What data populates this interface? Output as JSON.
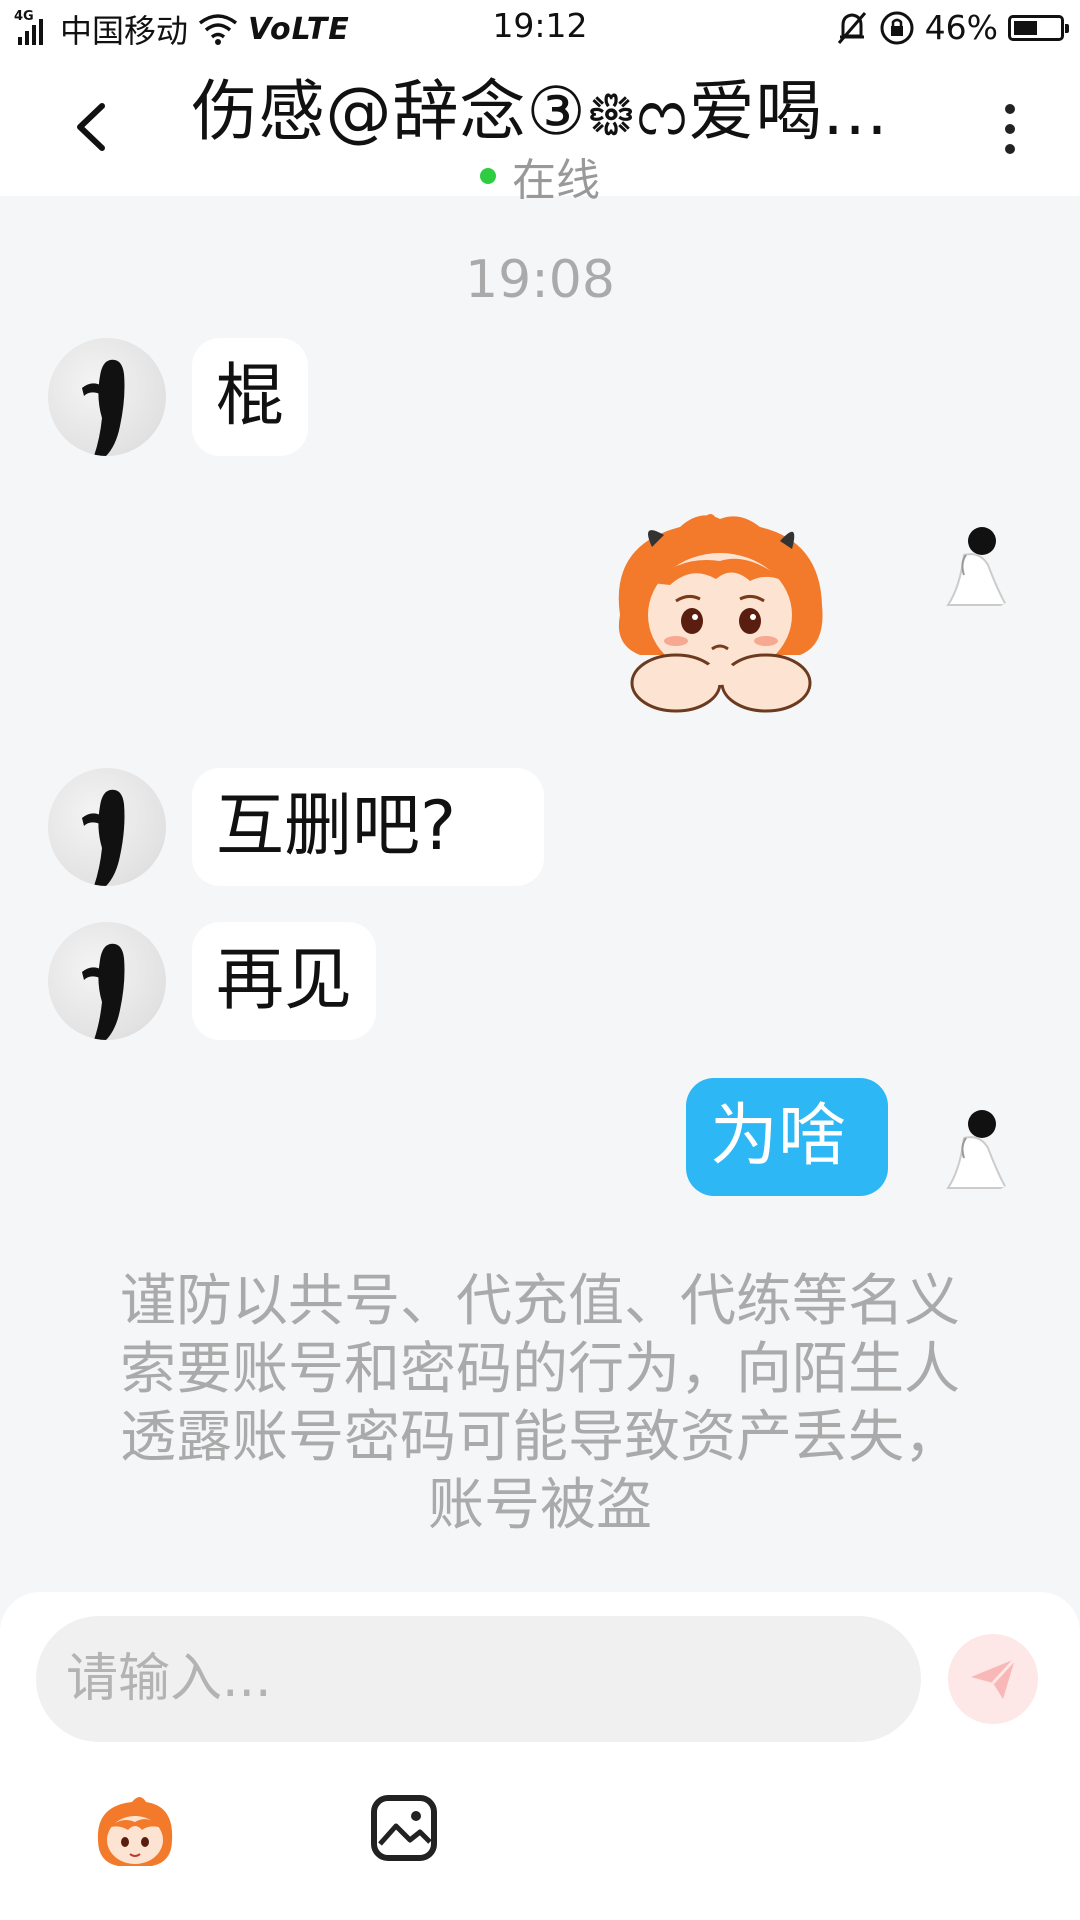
{
  "status_bar": {
    "network_tag": "4G",
    "carrier": "中国移动",
    "volte": "VoLTE",
    "time": "19:12",
    "battery_percent": "46%",
    "battery_level": 0.46
  },
  "header": {
    "title": "伤感@辞念③᪥ᦂ爱喝...",
    "status": "在线",
    "status_color": "#2ecc40"
  },
  "messages": {
    "timestamp": "19:08",
    "items": [
      {
        "side": "them",
        "type": "text",
        "text": "棍"
      },
      {
        "side": "me",
        "type": "sticker",
        "sticker": "sad-orange-hair-girl-sticker"
      },
      {
        "side": "them",
        "type": "text",
        "text": "互删吧?"
      },
      {
        "side": "them",
        "type": "text",
        "text": "再见"
      },
      {
        "side": "me",
        "type": "text",
        "text": "为啥"
      }
    ]
  },
  "notice": {
    "text": "谨防以共号、代充值、代练等名义索要账号和密码的行为，向陌生人透露账号密码可能导致资产丢失，账号被盗"
  },
  "input": {
    "placeholder": "请输入..."
  },
  "colors": {
    "accent_bubble": "#2db7f5",
    "background": "#f5f6f8",
    "send_button": "#fde7e7"
  },
  "icons": {
    "back": "chevron-left-icon",
    "more": "more-vertical-icon",
    "send": "send-icon",
    "emoji": "emoji-sticker-icon",
    "image": "image-icon"
  }
}
